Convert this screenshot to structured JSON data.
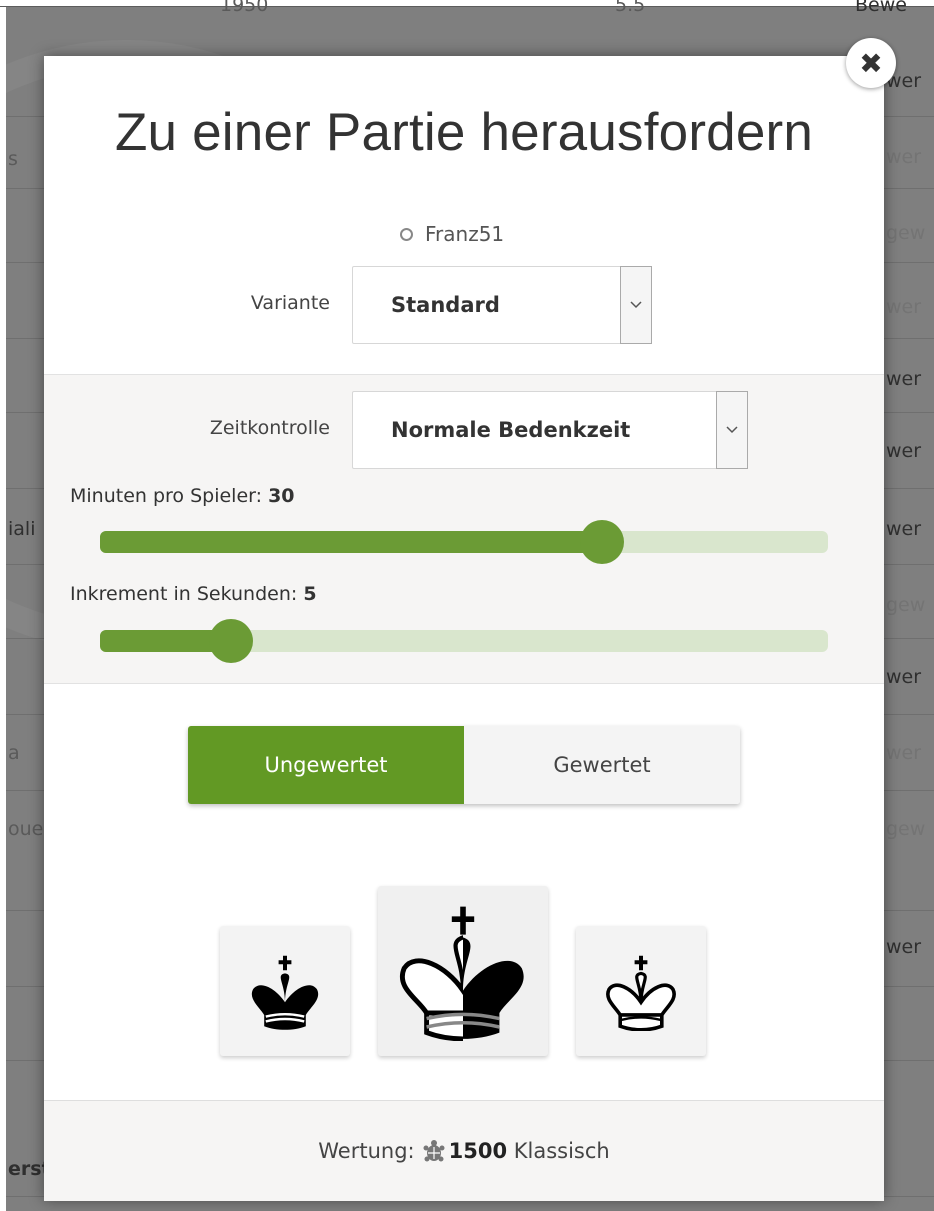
{
  "background": {
    "fragments": [
      "1950",
      "5.5",
      "Bewe",
      "wer",
      "s",
      "wer",
      "gew",
      "wer",
      "wer",
      "wer",
      "iali",
      "wer",
      "gew",
      "wer",
      "a",
      "wer",
      "oue",
      "gew",
      "wer",
      "erst"
    ]
  },
  "dialog": {
    "title": "Zu einer Partie herausfordern",
    "close_icon": "times-icon",
    "opponent": "Franz51",
    "variant": {
      "label": "Variante",
      "value": "Standard"
    },
    "time_control": {
      "label": "Zeitkontrolle",
      "value": "Normale Bedenkzeit"
    },
    "minutes": {
      "label": "Minuten pro Spieler: ",
      "value": "30",
      "slider_fraction": 0.69
    },
    "increment": {
      "label": "Inkrement in Sekunden: ",
      "value": "5",
      "slider_fraction": 0.18
    },
    "mode": {
      "casual": "Ungewertet",
      "rated": "Gewertet",
      "selected": "casual"
    },
    "colors": [
      {
        "name": "black",
        "icon": "black-king-icon"
      },
      {
        "name": "random",
        "icon": "random-king-icon"
      },
      {
        "name": "white",
        "icon": "white-king-icon"
      }
    ],
    "rating": {
      "prefix": "Wertung: ",
      "icon": "turtle-icon",
      "value": "1500",
      "suffix": " Klassisch"
    }
  },
  "colors": {
    "accent": "#629924",
    "slider_track": "#d9e6cd"
  }
}
